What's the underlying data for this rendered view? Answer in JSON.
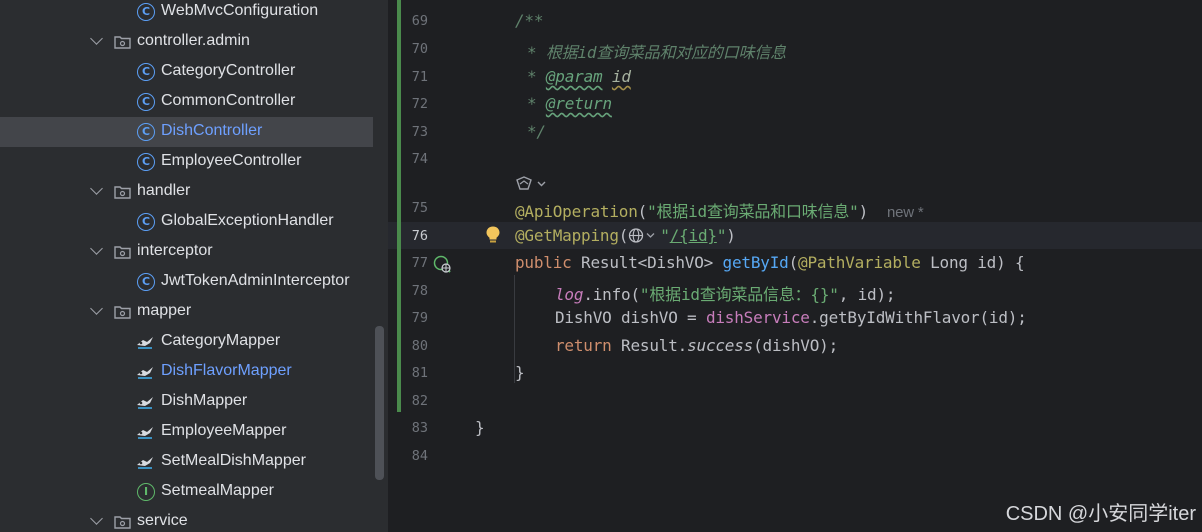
{
  "project_tree": {
    "items": [
      {
        "label": "WebMvcConfiguration",
        "kind": "class"
      },
      {
        "label": "controller.admin",
        "kind": "package"
      },
      {
        "label": "CategoryController",
        "kind": "class"
      },
      {
        "label": "CommonController",
        "kind": "class"
      },
      {
        "label": "DishController",
        "kind": "class",
        "selected": true
      },
      {
        "label": "EmployeeController",
        "kind": "class"
      },
      {
        "label": "handler",
        "kind": "package"
      },
      {
        "label": "GlobalExceptionHandler",
        "kind": "class"
      },
      {
        "label": "interceptor",
        "kind": "package"
      },
      {
        "label": "JwtTokenAdminInterceptor",
        "kind": "class"
      },
      {
        "label": "mapper",
        "kind": "package"
      },
      {
        "label": "CategoryMapper",
        "kind": "mybatis-mapper"
      },
      {
        "label": "DishFlavorMapper",
        "kind": "mybatis-mapper",
        "modified": true
      },
      {
        "label": "DishMapper",
        "kind": "mybatis-mapper"
      },
      {
        "label": "EmployeeMapper",
        "kind": "mybatis-mapper"
      },
      {
        "label": "SetMealDishMapper",
        "kind": "mybatis-mapper"
      },
      {
        "label": "SetmealMapper",
        "kind": "interface"
      },
      {
        "label": "service",
        "kind": "package"
      }
    ]
  },
  "editor": {
    "line_numbers": [
      "69",
      "70",
      "71",
      "72",
      "73",
      "74",
      "75",
      "76",
      "77",
      "78",
      "79",
      "80",
      "81",
      "82",
      "83",
      "84"
    ],
    "active_line": "76",
    "code": {
      "l69": "/**",
      "l70": "* 根据id查询菜品和对应的口味信息",
      "l71_star": "* ",
      "l71_tag": "@param",
      "l71_name": "id",
      "l72_star": "* ",
      "l72_tag": "@return",
      "l73": "*/",
      "l75_ann": "@ApiOperation",
      "l75_open": "(",
      "l75_str": "\"根据id查询菜品和口味信息\"",
      "l75_close": ")",
      "l75_hint": "new *",
      "l76_ann": "@GetMapping",
      "l76_open": "(",
      "l76_str_open": "\"",
      "l76_path": "/{id}",
      "l76_str_close": "\"",
      "l76_close": ")",
      "l77_kw": "public",
      "l77_type": " Result<DishVO> ",
      "l77_fn": "getById",
      "l77_open": "(",
      "l77_ann": "@PathVariable",
      "l77_rest": " Long id) {",
      "l78_log": "log",
      "l78_call": ".info(",
      "l78_str": "\"根据id查询菜品信息：{}\"",
      "l78_rest": ", id);",
      "l79_decl": "DishVO dishVO = ",
      "l79_field": "dishService",
      "l79_rest": ".getByIdWithFlavor(id);",
      "l80_kw": "return",
      "l80_mid": " Result.",
      "l80_fn": "success",
      "l80_rest": "(dishVO);",
      "l81": "}",
      "l83": "}"
    }
  },
  "watermark": "CSDN @小安同学iter"
}
